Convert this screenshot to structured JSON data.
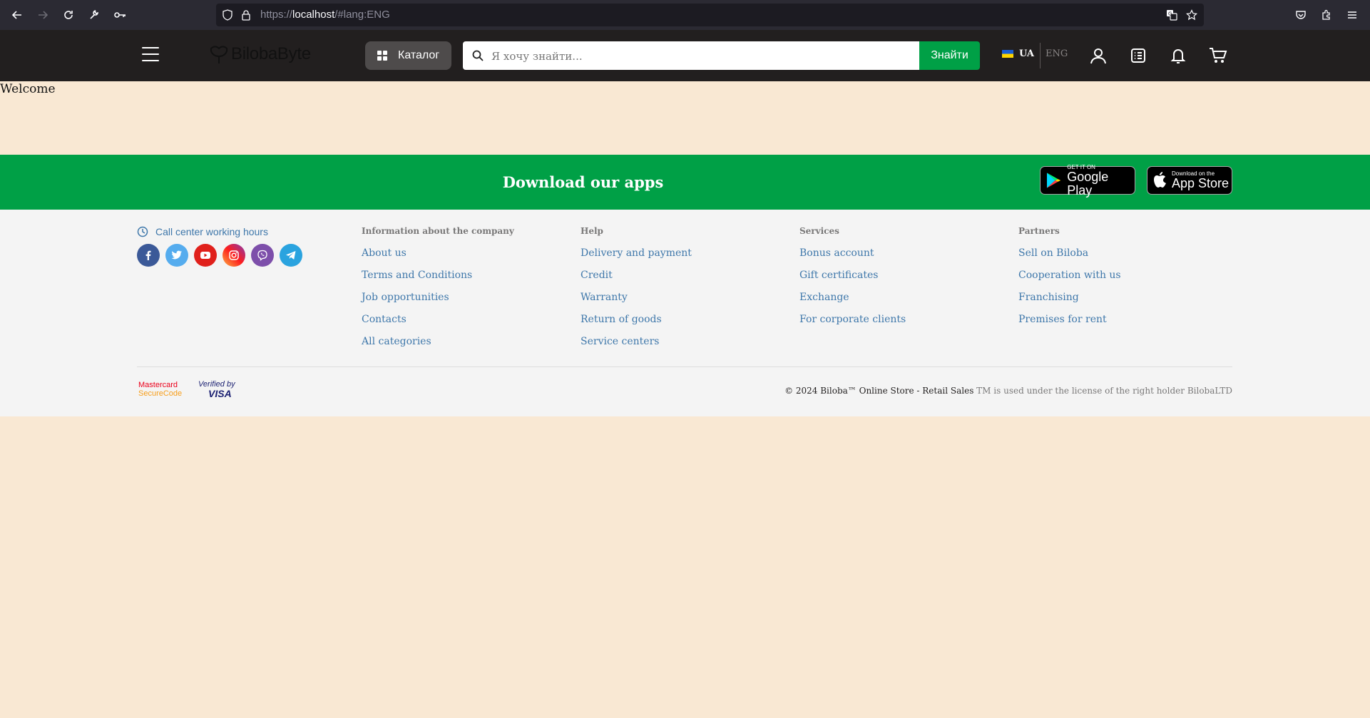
{
  "browser": {
    "url_scheme": "https://",
    "url_host": "localhost",
    "url_path": "/#lang:ENG"
  },
  "header": {
    "logo_text": "BilobaByte",
    "catalog_label": "Каталог",
    "search_placeholder": "Я хочу знайти...",
    "search_button": "Знайти",
    "lang_ua": "UA",
    "lang_eng": "ENG"
  },
  "main": {
    "welcome": "Welcome"
  },
  "apps_banner": {
    "title": "Download our apps",
    "google_play_small": "GET IT ON",
    "google_play_big": "Google Play",
    "app_store_small": "Download on the",
    "app_store_big": "App Store"
  },
  "footer": {
    "call_center": "Call center working hours",
    "socials": [
      "facebook-icon",
      "twitter-icon",
      "youtube-icon",
      "instagram-icon",
      "viber-icon",
      "telegram-icon"
    ],
    "columns": [
      {
        "title": "Information about the company",
        "links": [
          "About us",
          "Terms and Conditions",
          "Job opportunities",
          "Contacts",
          "All categories"
        ]
      },
      {
        "title": "Help",
        "links": [
          "Delivery and payment",
          "Credit",
          "Warranty",
          "Return of goods",
          "Service centers"
        ]
      },
      {
        "title": "Services",
        "links": [
          "Bonus account",
          "Gift certificates",
          "Exchange",
          "For corporate clients"
        ]
      },
      {
        "title": "Partners",
        "links": [
          "Sell on Biloba",
          "Cooperation with us",
          "Franchising",
          "Premises for rent"
        ]
      }
    ],
    "payments": {
      "mastercard_line1": "Mastercard",
      "mastercard_line2": "SecureCode",
      "visa_line1": "Verified by",
      "visa_line2": "VISA"
    },
    "copyright_main": "© 2024 Biloba™ Online Store - Retail Sales",
    "copyright_tail": " TM is used under the license of the right holder BilobaLTD"
  },
  "colors": {
    "page_bg": "#f9e8d3",
    "header_bg": "#221f1f",
    "accent_green": "#00a046",
    "link_blue": "#3e77aa"
  }
}
